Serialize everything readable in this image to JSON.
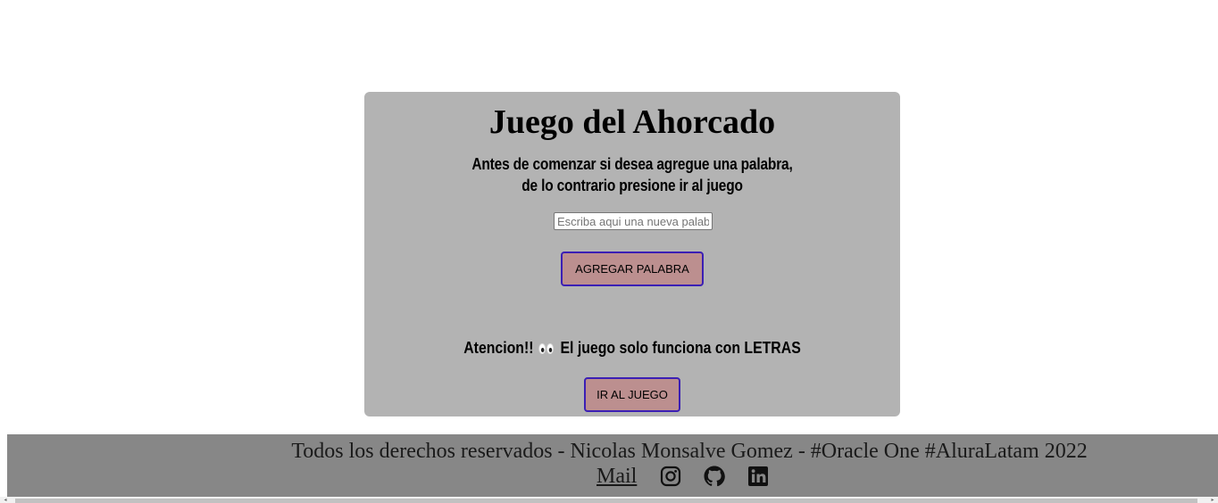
{
  "game": {
    "title": "Juego del Ahorcado",
    "subtitle_line1": "Antes de comenzar si desea agregue una palabra,",
    "subtitle_line2": "de lo contrario presione ir al juego",
    "input_placeholder": "Escriba aqui una nueva palabra",
    "input_value": "",
    "add_button_label": "AGREGAR PALABRA",
    "warning_prefix": "Atencion!!",
    "warning_suffix": "El juego solo funciona con LETRAS",
    "go_button_label": "IR AL JUEGO"
  },
  "footer": {
    "text": "Todos los derechos reservados - Nicolas Monsalve Gomez - #Oracle One #AluraLatam 2022",
    "mail_label": "Mail",
    "social_icons": [
      "instagram-icon",
      "github-icon",
      "linkedin-icon"
    ]
  },
  "colors": {
    "card_background": "#b3b3b3",
    "button_background": "#bc8f8f",
    "button_border": "#3b1fb4",
    "footer_background": "#878787"
  }
}
